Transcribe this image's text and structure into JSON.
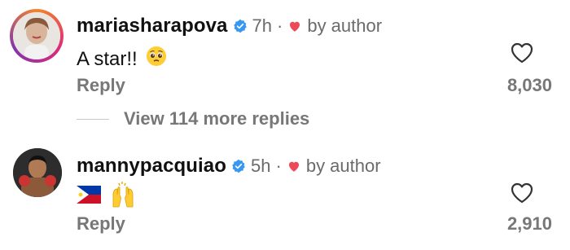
{
  "comments": [
    {
      "username": "mariasharapova",
      "time": "7h",
      "separator": "·",
      "by_author": "by author",
      "text": "A star!!",
      "reply": "Reply",
      "likes": "8,030"
    },
    {
      "username": "mannypacquiao",
      "time": "5h",
      "separator": "·",
      "by_author": "by author",
      "text": "",
      "reply": "Reply",
      "likes": "2,910"
    }
  ],
  "view_more": {
    "label": "View 114 more replies"
  },
  "icons": {
    "verified": "verified-badge-icon",
    "author_heart": "red-heart-icon",
    "like": "heart-outline-icon",
    "emoji_1": "pleading-face-emoji",
    "emoji_2": "philippines-flag-emoji",
    "emoji_3": "raised-hands-emoji"
  },
  "colors": {
    "verified": "#3897f0",
    "heart": "#ed4956",
    "muted": "#777777"
  }
}
